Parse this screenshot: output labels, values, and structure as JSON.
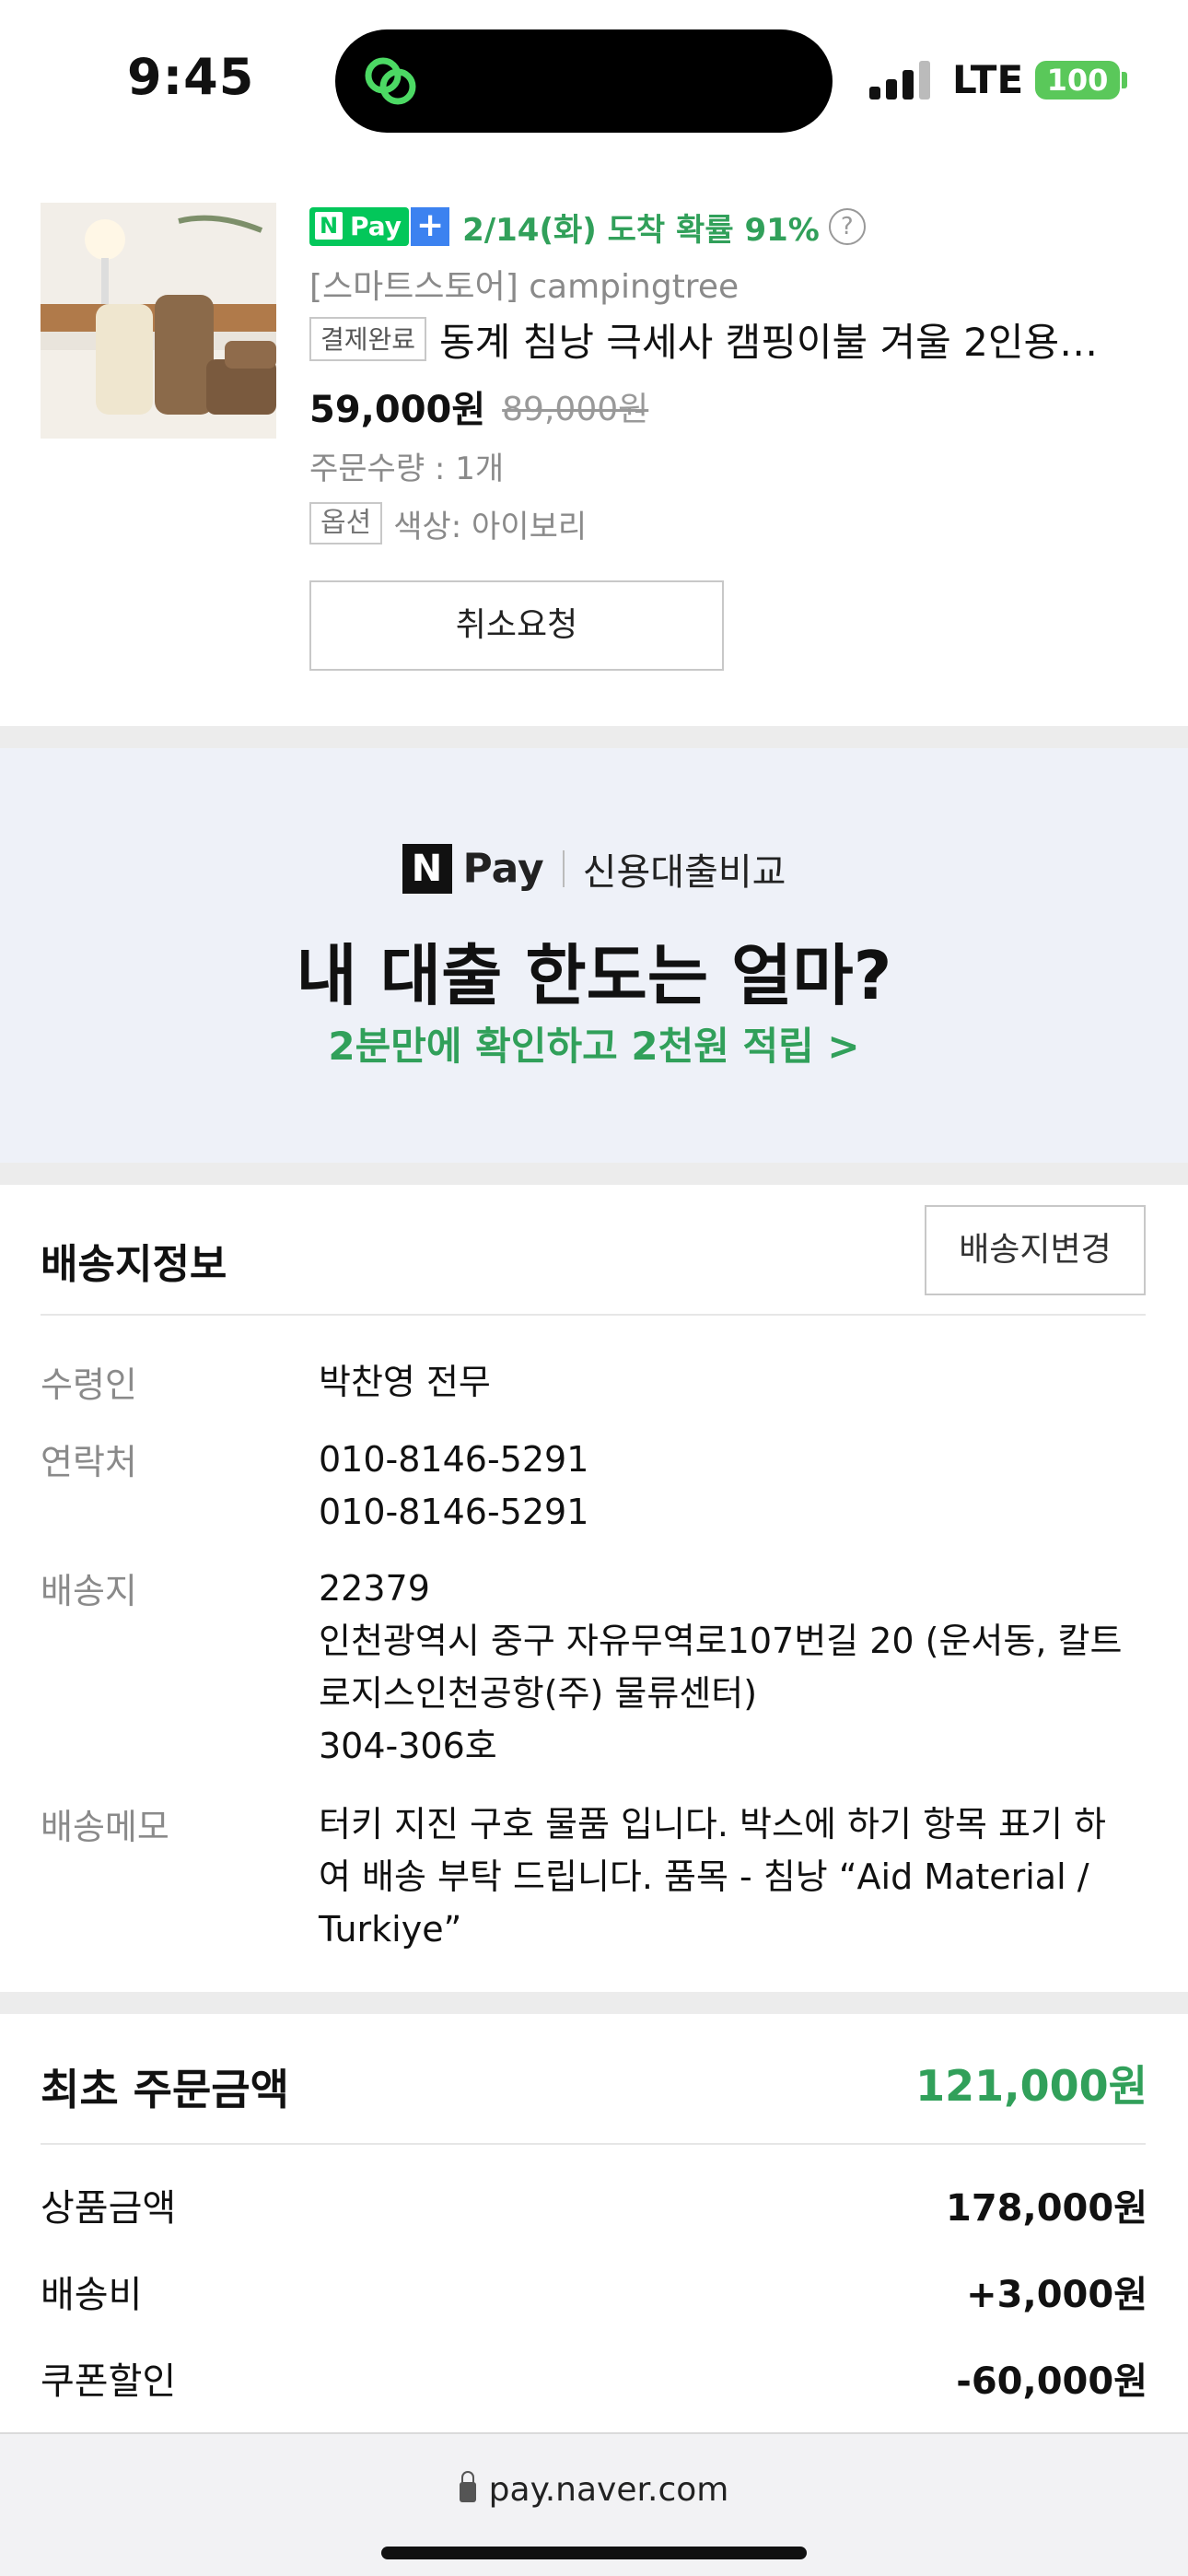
{
  "status_bar": {
    "time": "9:45",
    "network": "LTE",
    "battery": "100"
  },
  "product": {
    "npay_label": "Pay",
    "npay_n": "N",
    "plus": "+",
    "arrival": "2/14(화) 도착 확률 91%",
    "help": "?",
    "store": "[스마트스토어] campingtree",
    "status": "결제완료",
    "title": "동계 침낭 극세사 캠핑이불 겨울 2인용…",
    "price": "59,000원",
    "original_price": "89,000원",
    "quantity": "주문수량 : 1개",
    "option_tag": "옵션",
    "option_value": "색상: 아이보리",
    "cancel_button": "취소요청"
  },
  "banner": {
    "brand_n": "N",
    "brand_pay": "Pay",
    "service": "신용대출비교",
    "headline": "내 대출 한도는 얼마?",
    "subline": "2분만에 확인하고 2천원 적립 >"
  },
  "delivery": {
    "title": "배송지정보",
    "change_button": "배송지변경",
    "recipient_label": "수령인",
    "recipient": "박찬영 전무",
    "contact_label": "연락처",
    "contact_1": "010-8146-5291",
    "contact_2": "010-8146-5291",
    "address_label": "배송지",
    "postcode": "22379",
    "address_line1": "인천광역시 중구 자유무역로107번길 20 (운서동, 칼트",
    "address_line2": "로지스인천공항(주) 물류센터)",
    "address_line3": "304-306호",
    "memo_label": "배송메모",
    "memo_line1": "터키 지진 구호 물품 입니다. 박스에 하기 항목 표기 하",
    "memo_line2": "여 배송 부탁 드립니다. 품목 - 침낭 “Aid Material /",
    "memo_line3": "Turkiye”"
  },
  "amount": {
    "title": "최초 주문금액",
    "total": "121,000원",
    "rows": [
      {
        "label": "상품금액",
        "value": "178,000원"
      },
      {
        "label": "배송비",
        "value": "+3,000원"
      },
      {
        "label": "쿠폰할인",
        "value": "-60,000원"
      }
    ]
  },
  "browser": {
    "url": "pay.naver.com"
  },
  "colors": {
    "naver_green": "#03c75a",
    "accent_green": "#31a05a",
    "plus_blue": "#3c82f0"
  }
}
